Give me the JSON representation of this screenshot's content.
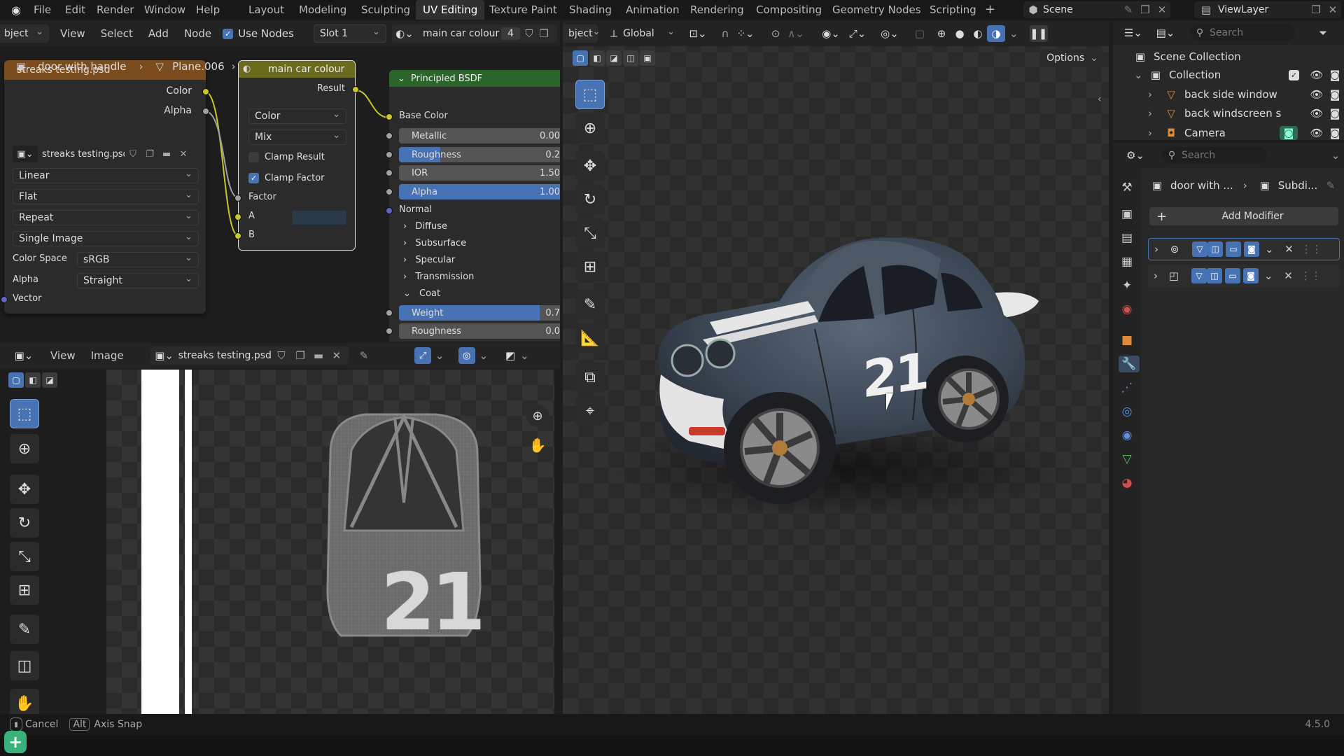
{
  "menu": {
    "items": [
      "File",
      "Edit",
      "Render",
      "Window",
      "Help"
    ]
  },
  "workspaces": {
    "items": [
      "Layout",
      "Modeling",
      "Sculpting",
      "UV Editing",
      "Texture Paint",
      "Shading",
      "Animation",
      "Rendering",
      "Compositing",
      "Geometry Nodes",
      "Scripting"
    ],
    "active": "UV Editing",
    "add": "+"
  },
  "scene": {
    "label": "Scene",
    "viewlayer": "ViewLayer"
  },
  "node_header": {
    "object_mode": "bject",
    "view": "View",
    "select": "Select",
    "add": "Add",
    "node": "Node",
    "use_nodes": "Use Nodes",
    "slot": "Slot 1",
    "material": "main car colour",
    "users": "4"
  },
  "breadcrumb": {
    "object": "door with handle",
    "mesh": "Plane.006",
    "material": "main car colour"
  },
  "image_node": {
    "header": "streaks testing.psd",
    "out_color": "Color",
    "out_alpha": "Alpha",
    "image_name": "streaks testing.psd",
    "interpolation": "Linear",
    "projection": "Flat",
    "extension": "Repeat",
    "source": "Single Image",
    "color_space_label": "Color Space",
    "color_space": "sRGB",
    "alpha_label": "Alpha",
    "alpha_mode": "Straight",
    "vector": "Vector"
  },
  "mix_node": {
    "header": "main car colour",
    "header_ghost": "Mix",
    "result": "Result",
    "data_type": "Color",
    "blend": "Mix",
    "clamp_result": "Clamp Result",
    "clamp_factor": "Clamp Factor",
    "factor": "Factor",
    "a": "A",
    "b": "B"
  },
  "bsdf_node": {
    "header": "Principled BSDF",
    "base_color": "Base Color",
    "metallic": "Metallic",
    "metallic_val": "0.00",
    "roughness": "Roughness",
    "roughness_val": "0.2",
    "roughness_fill": 0.25,
    "ior": "IOR",
    "ior_val": "1.50",
    "alpha": "Alpha",
    "alpha_val": "1.00",
    "alpha_fill": 1.0,
    "normal": "Normal",
    "diffuse": "Diffuse",
    "subsurface": "Subsurface",
    "specular": "Specular",
    "transmission": "Transmission",
    "coat": "Coat",
    "weight": "Weight",
    "weight_val": "0.7",
    "weight_fill": 0.85,
    "coat_roughness": "Roughness",
    "coat_roughness_val": "0.0"
  },
  "image_editor": {
    "view": "View",
    "image": "Image",
    "image_name": "streaks testing.psd",
    "uv_number": "21"
  },
  "viewport": {
    "object_mode": "bject",
    "orientation": "Global",
    "options": "Options",
    "car_number": "21"
  },
  "outliner": {
    "search": "Search",
    "scene_collection": "Scene Collection",
    "collection": "Collection",
    "items": [
      "back side window",
      "back windscreen s",
      "Camera"
    ]
  },
  "properties": {
    "search": "Search",
    "object": "door with ...",
    "modifier": "Subdi...",
    "add_modifier": "Add Modifier"
  },
  "status": {
    "cancel": "Cancel",
    "alt": "Alt",
    "axis_snap": "Axis Snap",
    "version": "4.5.0"
  },
  "colors": {
    "accent": "#4772b3",
    "socket_yellow": "#c7c729",
    "socket_purple": "#6363c7",
    "node_green": "#2b652b",
    "node_orange": "#7b4d1e",
    "mix_header": "#6b6b1e"
  }
}
